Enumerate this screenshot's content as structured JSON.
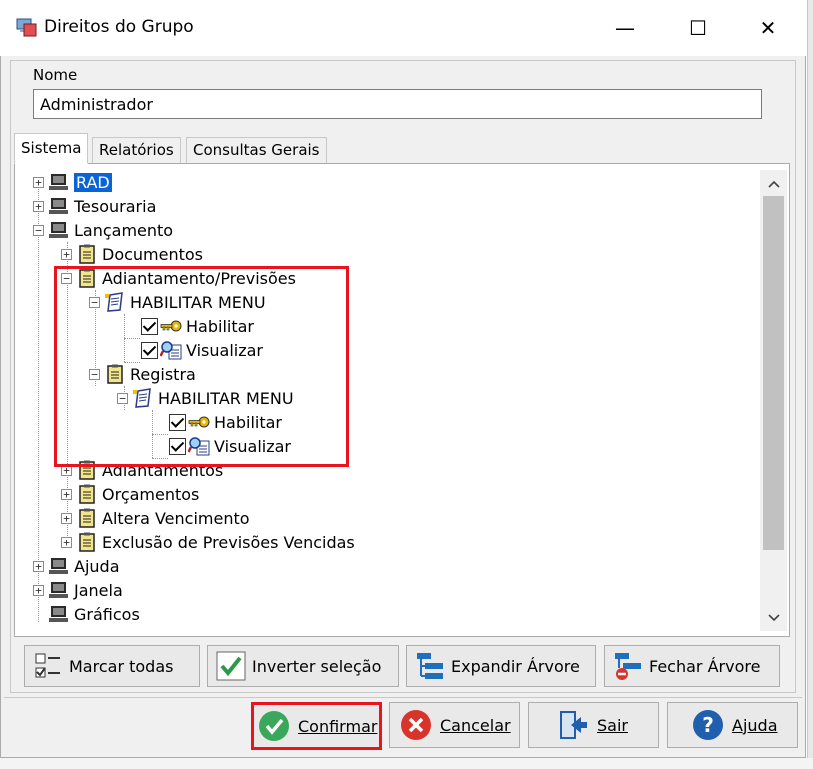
{
  "window": {
    "title": "Direitos do Grupo",
    "minimize": "—",
    "maximize": "☐",
    "close": "✕"
  },
  "form": {
    "name_label": "Nome",
    "name_value": "Administrador"
  },
  "tabs": [
    {
      "label": "Sistema",
      "active": true
    },
    {
      "label": "Relatórios",
      "active": false
    },
    {
      "label": "Consultas Gerais",
      "active": false
    }
  ],
  "tree": {
    "items": [
      {
        "label": "RAD",
        "level": 0,
        "expander": "+",
        "icon": "computer-icon",
        "selected": true
      },
      {
        "label": "Tesouraria",
        "level": 0,
        "expander": "+",
        "icon": "computer-icon"
      },
      {
        "label": "Lançamento",
        "level": 0,
        "expander": "−",
        "icon": "computer-icon"
      },
      {
        "label": "Documentos",
        "level": 1,
        "expander": "+",
        "icon": "clipboard-icon"
      },
      {
        "label": "Adiantamento/Previsões",
        "level": 1,
        "expander": "−",
        "icon": "clipboard-icon"
      },
      {
        "label": "HABILITAR MENU",
        "level": 2,
        "expander": "−",
        "icon": "notepad-icon"
      },
      {
        "label": "Habilitar",
        "level": 3,
        "checked": true,
        "icon": "key-icon"
      },
      {
        "label": "Visualizar",
        "level": 3,
        "checked": true,
        "icon": "magnifier-icon"
      },
      {
        "label": "Registra",
        "level": 2,
        "expander": "−",
        "icon": "clipboard-icon"
      },
      {
        "label": "HABILITAR MENU",
        "level": 3,
        "expander": "−",
        "icon": "notepad-icon"
      },
      {
        "label": "Habilitar",
        "level": 4,
        "checked": true,
        "icon": "key-icon"
      },
      {
        "label": "Visualizar",
        "level": 4,
        "checked": true,
        "icon": "magnifier-icon"
      },
      {
        "label": "Adiantamentos",
        "level": 1,
        "expander": "+",
        "icon": "clipboard-icon"
      },
      {
        "label": "Orçamentos",
        "level": 1,
        "expander": "+",
        "icon": "clipboard-icon"
      },
      {
        "label": "Altera Vencimento",
        "level": 1,
        "expander": "+",
        "icon": "clipboard-icon"
      },
      {
        "label": "Exclusão de Previsões Vencidas",
        "level": 1,
        "expander": "+",
        "icon": "clipboard-icon"
      },
      {
        "label": "Ajuda",
        "level": 0,
        "expander": "+",
        "icon": "computer-icon"
      },
      {
        "label": "Janela",
        "level": 0,
        "expander": "+",
        "icon": "computer-icon"
      },
      {
        "label": "Gráficos",
        "level": 0,
        "expander": "",
        "icon": "computer-icon"
      }
    ]
  },
  "tree_buttons": {
    "mark_all": "Marcar todas",
    "invert": "Inverter seleção",
    "expand": "Expandir Árvore",
    "collapse": "Fechar Árvore"
  },
  "footer_buttons": {
    "confirm": "Confirmar",
    "cancel": "Cancelar",
    "exit": "Sair",
    "help": "Ajuda"
  },
  "colors": {
    "highlight": "#e8141e",
    "selection": "#0a64d6",
    "confirm_green": "#3aa85a",
    "cancel_red": "#d9342b",
    "help_blue": "#1f5fae"
  }
}
